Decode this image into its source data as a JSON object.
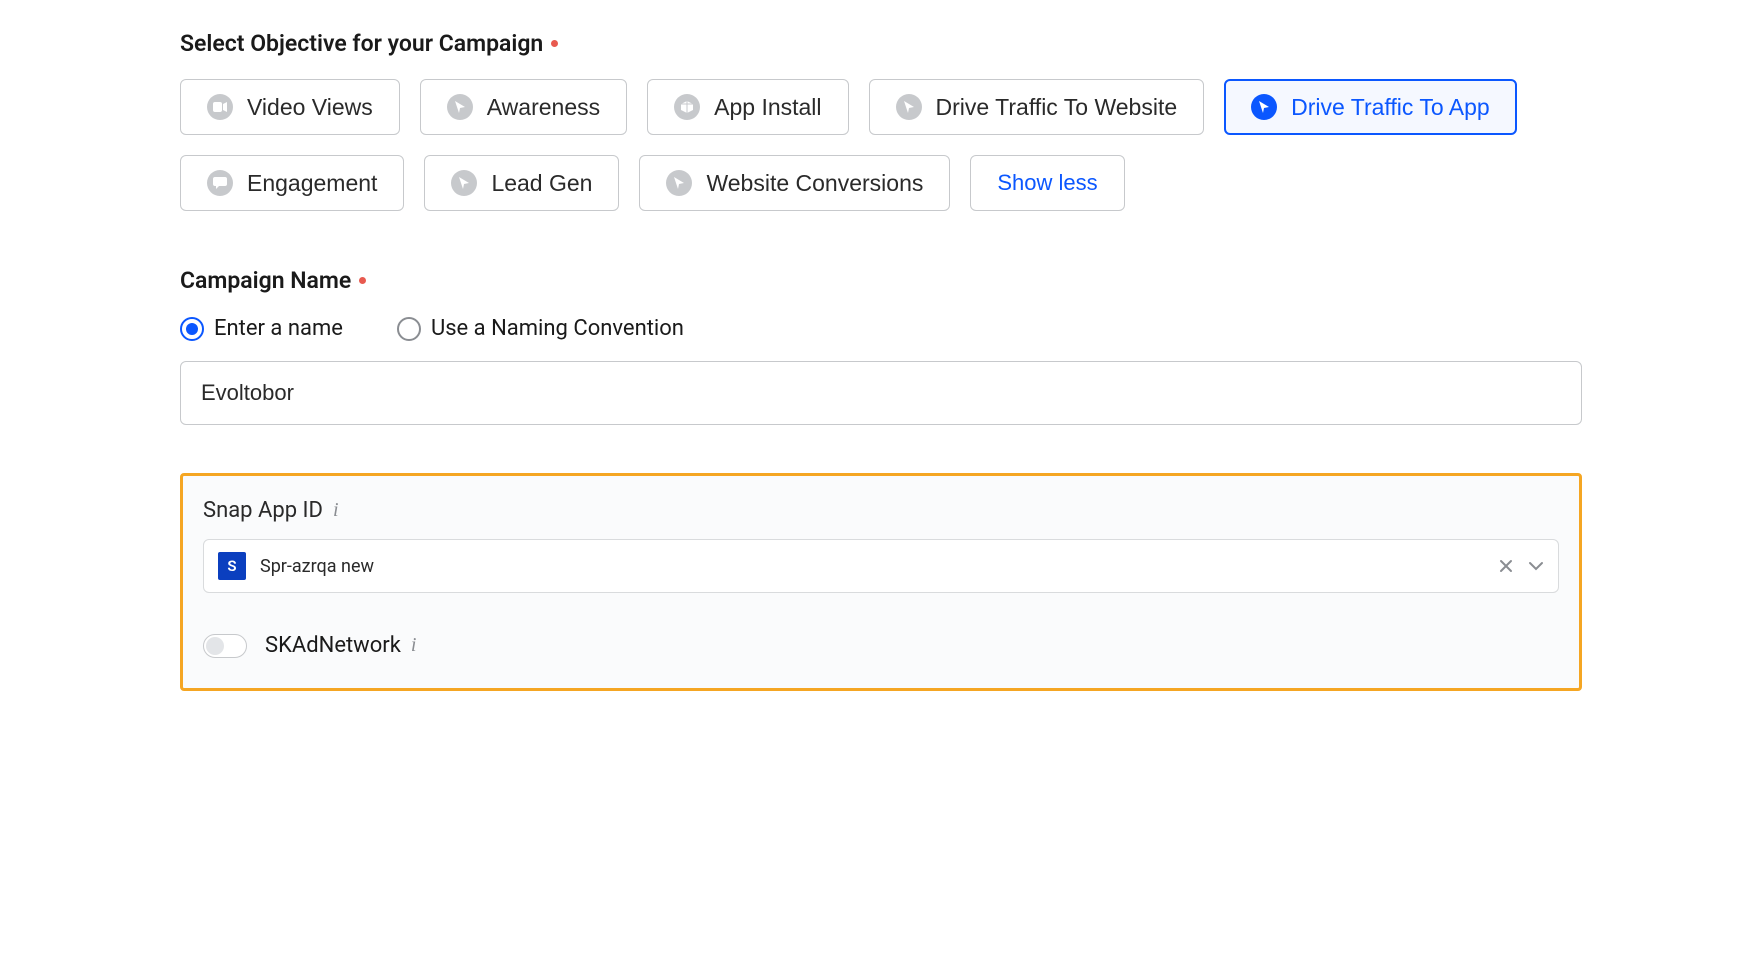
{
  "objective": {
    "title": "Select Objective for your Campaign",
    "options": [
      {
        "label": "Video Views",
        "icon": "video"
      },
      {
        "label": "Awareness",
        "icon": "cursor"
      },
      {
        "label": "App Install",
        "icon": "cube"
      },
      {
        "label": "Drive Traffic To Website",
        "icon": "cursor"
      },
      {
        "label": "Drive Traffic To App",
        "icon": "cursor"
      },
      {
        "label": "Engagement",
        "icon": "chat"
      },
      {
        "label": "Lead Gen",
        "icon": "cursor"
      },
      {
        "label": "Website Conversions",
        "icon": "cursor"
      }
    ],
    "selected": "Drive Traffic To App",
    "show_less": "Show less"
  },
  "campaign_name": {
    "title": "Campaign Name",
    "enter_label": "Enter a name",
    "convention_label": "Use a Naming Convention",
    "mode": "enter",
    "value": "Evoltobor"
  },
  "snap_app": {
    "label": "Snap App ID",
    "chip": "S",
    "value": "Spr-azrqa new"
  },
  "skad": {
    "label": "SKAdNetwork",
    "enabled": false
  }
}
